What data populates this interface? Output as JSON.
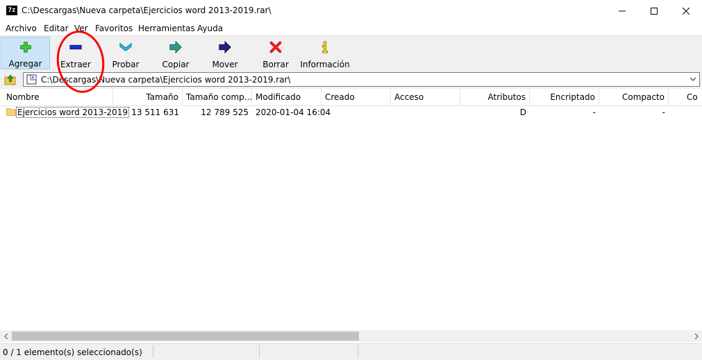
{
  "window": {
    "title": "C:\\Descargas\\Nueva carpeta\\Ejercicios word 2013-2019.rar\\",
    "app_icon_text": "7z"
  },
  "menu": [
    "Archivo",
    "Editar",
    "Ver",
    "Favoritos",
    "Herramientas",
    "Ayuda"
  ],
  "toolbar": {
    "add_label": "Agregar",
    "extract_label": "Extraer",
    "test_label": "Probar",
    "copy_label": "Copiar",
    "move_label": "Mover",
    "delete_label": "Borrar",
    "info_label": "Información"
  },
  "address": {
    "path": "C:\\Descargas\\Nueva carpeta\\Ejercicios word 2013-2019.rar\\"
  },
  "columns": [
    "Nombre",
    "Tamaño",
    "Tamaño comp...",
    "Modificado",
    "Creado",
    "Acceso",
    "Atributos",
    "Encriptado",
    "Compacto",
    "Co"
  ],
  "rows": [
    {
      "name": "Ejercicios word 2013-2019",
      "size": "13 511 631",
      "packed": "12 789 525",
      "modified": "2020-01-04 16:04",
      "created": "",
      "accessed": "",
      "attributes": "D",
      "encrypted": "-",
      "solid": "-"
    }
  ],
  "status": {
    "selection": "0 / 1 elemento(s) seleccionado(s)"
  },
  "colors": {
    "annotation": "#ff0000",
    "toolbar_bg": "#f0f0f0",
    "active_button_bg": "#cce4f7"
  }
}
